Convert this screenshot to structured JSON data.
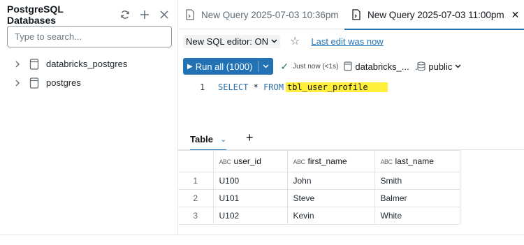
{
  "sidebar": {
    "title": "PostgreSQL Databases",
    "search_placeholder": "Type to search...",
    "items": [
      {
        "label": "databricks_postgres"
      },
      {
        "label": "postgres"
      }
    ]
  },
  "tabs": [
    {
      "label": "New Query 2025-07-03 10:36pm",
      "active": false
    },
    {
      "label": "New Query 2025-07-03 11:00pm",
      "active": true
    }
  ],
  "toolbar": {
    "editor_toggle": "New SQL editor: ON",
    "last_edit": "Last edit was now",
    "run_label": "Run all (1000)",
    "status": "Just now (<1s)",
    "catalog": "databricks_...",
    "catalog_prefix": ".",
    "schema": "public"
  },
  "editor": {
    "line_number": "1",
    "kw_select": "SELECT",
    "star": "*",
    "kw_from": "FROM",
    "table": "tbl_user_profile"
  },
  "results": {
    "tab_label": "Table",
    "columns": [
      {
        "type": "ABC",
        "name": "user_id"
      },
      {
        "type": "ABC",
        "name": "first_name"
      },
      {
        "type": "ABC",
        "name": "last_name"
      }
    ],
    "rows": [
      {
        "n": "1",
        "user_id": "U100",
        "first_name": "John",
        "last_name": "Smith"
      },
      {
        "n": "2",
        "user_id": "U101",
        "first_name": "Steve",
        "last_name": "Balmer"
      },
      {
        "n": "3",
        "user_id": "U102",
        "first_name": "Kevin",
        "last_name": "White"
      }
    ]
  },
  "colors": {
    "accent": "#2272b4",
    "highlight": "#ffef3b",
    "success": "#277c43"
  }
}
